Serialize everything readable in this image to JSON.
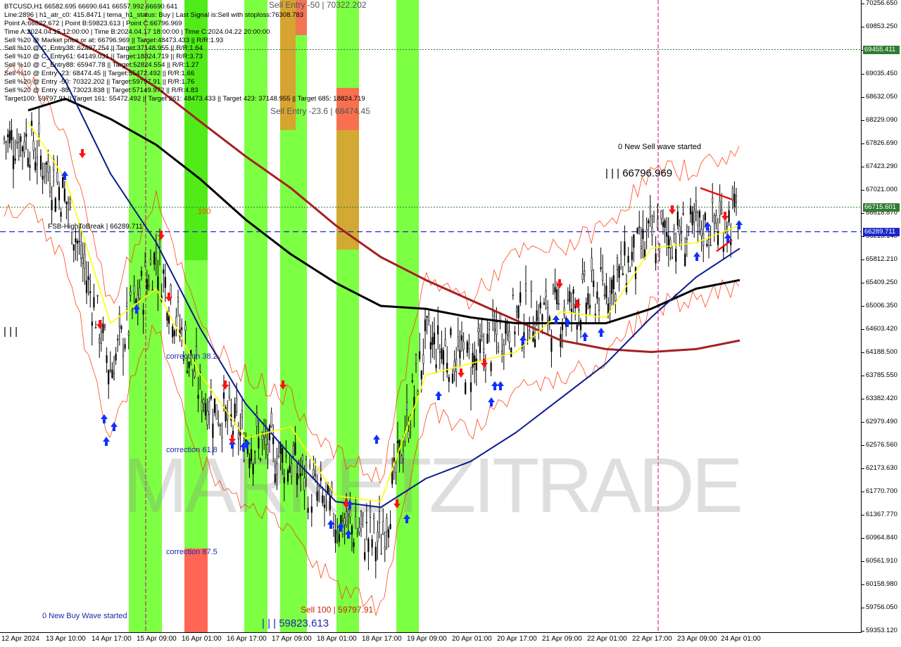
{
  "info_lines": [
    "BTCUSD,H1  66582.695 66690.641 66557.992 66690.641",
    "Line:2896 | h1_atr_c0: 415.8471 | tema_h1_status: Buy | Last Signal is:Sell with stoploss:76308.783",
    "Point A:66822.672 | Point B:59823.613 | Point C:66796.969",
    "Time A:2024.04.15 12:00:00 | Time B:2024.04.17 18:00:00 | Time C:2024.04.22 20:00:00",
    "Sell %20 @ Market price or at: 66796.969 || Target:48473.433 || R/R:1.93",
    "Sell %10 @ C_Entry38: 62497.254 || Target:37148.955 || R/R:1.64",
    "Sell %10 @ C_Entry61: 64149.031 || Target:18824.719 || R/R:3.73",
    "Sell %10 @ C_Entry88: 65947.78 || Target:52824.554 || R/R:1.27",
    "Sell %10 @ Entry -23: 68474.45 || Target:55472.492 || R/R:1.66",
    "Sell %20 @ Entry -50: 70322.202 || Target:59797.91 || R/R:1.76",
    "Sell %20 @ Entry -88: 73023.838 || Target:57149.972 || R/R:4.83",
    "Target100: 59797.91 || Target 161: 55472.492 || Target 261: 48473.433 || Target 423: 37148.955 || Target 685: 18824.719"
  ],
  "chart_labels": {
    "sell_entry_50": "Sell Entry -50 | 70322.202",
    "sell_entry_23": "Sell Entry -23.6 | 68474.45",
    "new_sell_wave": "0 New Sell wave started",
    "point_c": "| | | 66796.969",
    "fsb_high": "FSB-HighToBreak | 66289.711",
    "level_100": "100",
    "correction_38": "correction 38.2",
    "correction_61": "correction 61.8",
    "correction_87": "correction 87.5",
    "new_buy_wave": "0 New Buy Wave started",
    "sell_100": "Sell 100 | 59797.91",
    "point_b": "| | | 59823.613",
    "left_marker": "| | |",
    "watermark": "MARKETZITRADE"
  },
  "price_axis": {
    "ticks": [
      "70256.650",
      "69853.250",
      "69455.411",
      "69035.450",
      "68632.050",
      "68229.090",
      "67826.690",
      "67423.290",
      "67021.000",
      "66618.870",
      "66215.140",
      "65812.210",
      "65409.250",
      "65006.350",
      "64603.420",
      "64188.500",
      "63785.550",
      "63382.420",
      "62979.490",
      "62576.560",
      "62173.630",
      "61770.700",
      "61367.770",
      "60964.840",
      "60561.910",
      "60158.980",
      "59756.050",
      "59353.120"
    ],
    "tag_green_1": "69455.411",
    "tag_green_2": "66715.601",
    "tag_blue": "66289.711",
    "tag_green_1_color": "#2f7d32",
    "tag_blue_color": "#1b26c9"
  },
  "time_axis": {
    "labels": [
      "12 Apr 2024",
      "13 Apr 10:00",
      "14 Apr 17:00",
      "15 Apr 09:00",
      "16 Apr 01:00",
      "16 Apr 17:00",
      "17 Apr 09:00",
      "18 Apr 01:00",
      "18 Apr 17:00",
      "19 Apr 09:00",
      "20 Apr 01:00",
      "20 Apr 17:00",
      "21 Apr 09:00",
      "22 Apr 01:00",
      "22 Apr 17:00",
      "23 Apr 09:00",
      "24 Apr 01:00"
    ]
  },
  "colors": {
    "bull_band": "#66ff22",
    "bull_band_dark": "#33dd00",
    "sell_zone": "#ff6655",
    "sell_zone_orange": "#e09a30",
    "ema_slow": "#a52020",
    "ema_mid": "#000000",
    "ema_fast": "#0a1a8c",
    "tema": "#ffff00",
    "atr_band": "#ff3300",
    "up_arrow": "#1030ff",
    "down_arrow": "#ff1010"
  },
  "chart_data": {
    "type": "line",
    "symbol": "BTCUSD",
    "timeframe": "H1",
    "ylim": [
      59353.12,
      70256.65
    ],
    "x": [
      "12 Apr 2024",
      "13 Apr 10:00",
      "14 Apr 17:00",
      "15 Apr 09:00",
      "16 Apr 01:00",
      "16 Apr 17:00",
      "17 Apr 09:00",
      "18 Apr 01:00",
      "18 Apr 17:00",
      "19 Apr 09:00",
      "20 Apr 01:00",
      "20 Apr 17:00",
      "21 Apr 09:00",
      "22 Apr 01:00",
      "22 Apr 17:00",
      "23 Apr 09:00",
      "24 Apr 01:00"
    ],
    "series": [
      {
        "values": [
          67900,
          66900,
          63900,
          65900,
          63500,
          62700,
          62300,
          61300,
          60900,
          64400,
          64000,
          64800,
          64900,
          65300,
          66200,
          66300,
          66600
        ]
      },
      {
        "values": [
          68400,
          68600,
          68250,
          67800,
          67200,
          66500,
          65900,
          65400,
          65000,
          64950,
          64800,
          64700,
          64700,
          64700,
          64950,
          65300,
          65450
        ]
      },
      {
        "values": [
          70000,
          69700,
          69300,
          68800,
          68200,
          67600,
          67050,
          66400,
          65850,
          65450,
          65100,
          64750,
          64400,
          64250,
          64200,
          64250,
          64400
        ]
      },
      {
        "values": [
          69800,
          68900,
          67300,
          66100,
          64600,
          63300,
          62400,
          61600,
          61500,
          62000,
          62300,
          62800,
          63400,
          64000,
          64800,
          65500,
          66000
        ]
      },
      {
        "values": [
          68200,
          67200,
          64700,
          65300,
          63800,
          62700,
          62900,
          61700,
          61600,
          63800,
          64000,
          64200,
          64900,
          64800,
          66000,
          66100,
          66400
        ]
      }
    ],
    "levels": {
      "point_a": 66822.672,
      "point_b": 59823.613,
      "point_c": 66796.969,
      "fsb_high": 66289.711,
      "sell_entry_50": 70322.202,
      "sell_entry_23": 68474.45,
      "target_100": 59797.91,
      "current_close": 66690.641
    }
  }
}
